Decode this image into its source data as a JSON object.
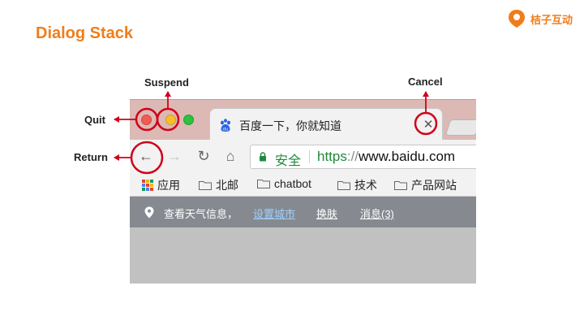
{
  "slide": {
    "title": "Dialog Stack",
    "brand": "桔子互动"
  },
  "annotations": {
    "suspend": "Suspend",
    "cancel": "Cancel",
    "quit": "Quit",
    "return": "Return"
  },
  "browser": {
    "tab": {
      "title": "百度一下，你就知道",
      "close_glyph": "✕",
      "favicon": "baidu-paw-icon"
    },
    "toolbar": {
      "back_glyph": "←",
      "forward_glyph": "→",
      "reload_glyph": "↻",
      "home_glyph": "⌂"
    },
    "omnibox": {
      "security_label": "安全",
      "url_scheme": "https",
      "url_separator": "://",
      "url_host": "www.baidu.com"
    },
    "bookmarks": [
      {
        "label": "应用",
        "icon": "apps-grid-icon"
      },
      {
        "label": "北邮",
        "icon": "folder-icon"
      },
      {
        "label": "chatbot",
        "icon": "folder-icon"
      },
      {
        "label": "技术",
        "icon": "folder-icon"
      },
      {
        "label": "产品网站",
        "icon": "folder-icon"
      }
    ],
    "baidu_bar": {
      "weather_text": "查看天气信息，",
      "set_city": "设置城市",
      "skin": "换肤",
      "messages": "消息(3)"
    }
  },
  "colors": {
    "accent": "#F07D1A",
    "annotation": "#D0021B",
    "tabbar": "#DCB9B4",
    "secure": "#1E8A3A"
  }
}
